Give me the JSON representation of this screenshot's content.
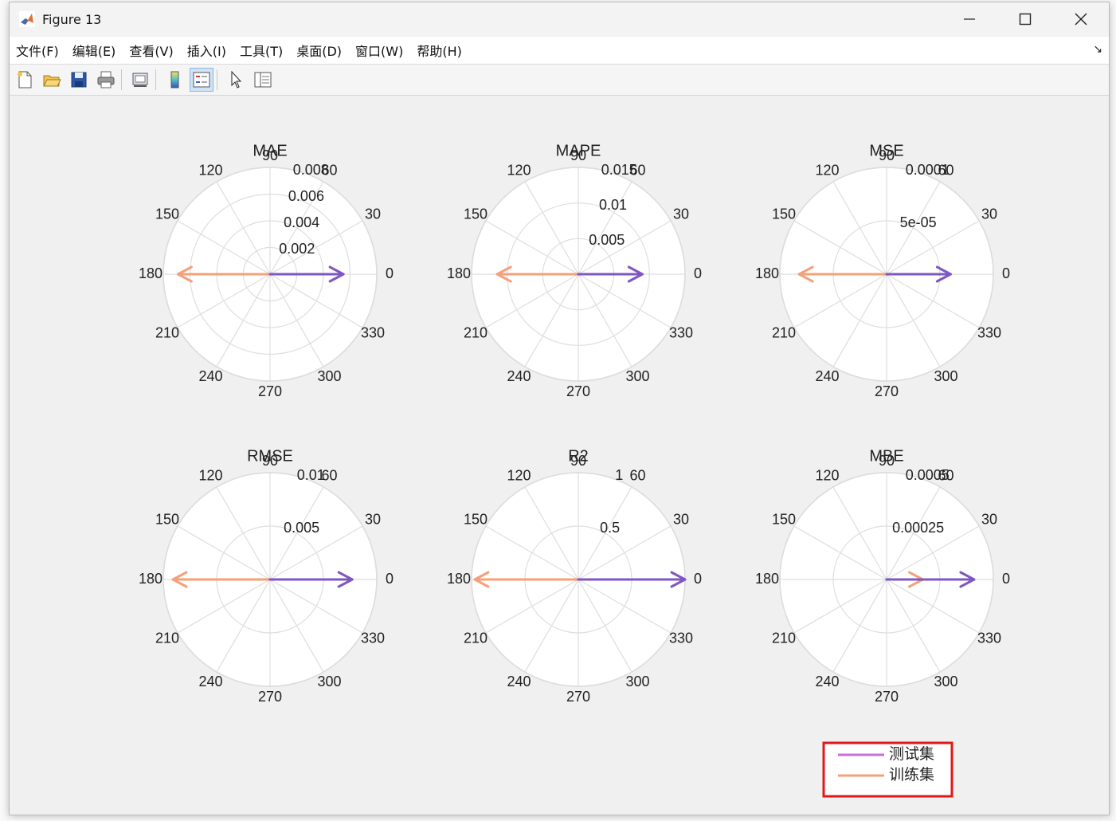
{
  "window": {
    "title": "Figure 13",
    "controls": [
      "minimize",
      "maximize",
      "close"
    ]
  },
  "menu": [
    "文件(F)",
    "编辑(E)",
    "查看(V)",
    "插入(I)",
    "工具(T)",
    "桌面(D)",
    "窗口(W)",
    "帮助(H)"
  ],
  "toolbar": [
    "new-figure-icon",
    "open-icon",
    "save-icon",
    "print-icon",
    "link-plot-icon",
    "colorbar-icon",
    "legend-icon",
    "pointer-icon",
    "property-inspector-icon"
  ],
  "colors": {
    "test": "#7e57c2",
    "train": "#f4a07a",
    "legend_test": "#c86fd8",
    "legend_box": "#e01818",
    "grid": "#dedede"
  },
  "chart_data": [
    {
      "type": "polar-compass",
      "title": "MAE",
      "rmax": 0.008,
      "rticks": [
        0.002,
        0.004,
        0.006,
        0.008
      ],
      "rtick_labels": [
        "0.002",
        "0.004",
        "0.006",
        "0.008"
      ],
      "series": [
        {
          "name": "测试集",
          "r": 0.0055,
          "theta": 0
        },
        {
          "name": "训练集",
          "r": 0.0069,
          "theta": 180
        }
      ]
    },
    {
      "type": "polar-compass",
      "title": "MAPE",
      "rmax": 0.015,
      "rticks": [
        0.005,
        0.01,
        0.015
      ],
      "rtick_labels": [
        "0.005",
        "0.01",
        "0.015"
      ],
      "series": [
        {
          "name": "测试集",
          "r": 0.009,
          "theta": 0
        },
        {
          "name": "训练集",
          "r": 0.0114,
          "theta": 180
        }
      ]
    },
    {
      "type": "polar-compass",
      "title": "MSE",
      "rmax": 0.0001,
      "rticks": [
        5e-05,
        0.0001
      ],
      "rtick_labels": [
        "5e-05",
        "0.0001"
      ],
      "series": [
        {
          "name": "测试集",
          "r": 6e-05,
          "theta": 0
        },
        {
          "name": "训练集",
          "r": 8.2e-05,
          "theta": 180
        }
      ]
    },
    {
      "type": "polar-compass",
      "title": "RMSE",
      "rmax": 0.01,
      "rticks": [
        0.005,
        0.01
      ],
      "rtick_labels": [
        "0.005",
        "0.01"
      ],
      "series": [
        {
          "name": "测试集",
          "r": 0.0077,
          "theta": 0
        },
        {
          "name": "训练集",
          "r": 0.0091,
          "theta": 180
        }
      ]
    },
    {
      "type": "polar-compass",
      "title": "R2",
      "rmax": 1,
      "rticks": [
        0.5,
        1
      ],
      "rtick_labels": [
        "0.5",
        "1"
      ],
      "series": [
        {
          "name": "测试集",
          "r": 1.0,
          "theta": 0
        },
        {
          "name": "训练集",
          "r": 0.97,
          "theta": 180
        }
      ]
    },
    {
      "type": "polar-compass",
      "title": "MBE",
      "rmax": 0.0005,
      "rticks": [
        0.00025,
        0.0005
      ],
      "rtick_labels": [
        "0.00025",
        "0.0005"
      ],
      "series": [
        {
          "name": "测试集",
          "r": 0.00041,
          "theta": 0
        },
        {
          "name": "训练集",
          "r": 0.00017,
          "theta": 0
        }
      ]
    }
  ],
  "angle_labels": [
    "0",
    "30",
    "60",
    "90",
    "120",
    "150",
    "180",
    "210",
    "240",
    "270",
    "300",
    "330"
  ],
  "legend": [
    "测试集",
    "训练集"
  ]
}
